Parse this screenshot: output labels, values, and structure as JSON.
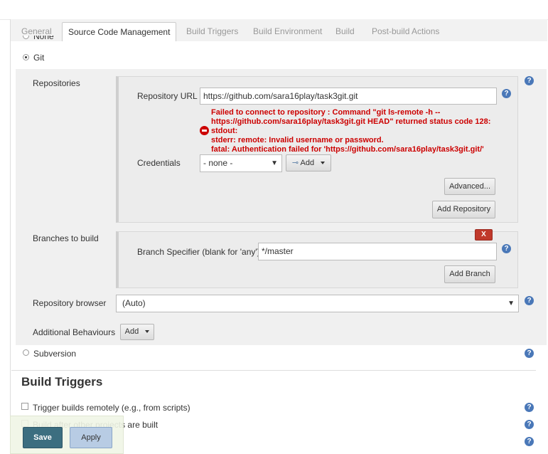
{
  "tabs": [
    {
      "label": "General"
    },
    {
      "label": "Source Code Management"
    },
    {
      "label": "Build Triggers"
    },
    {
      "label": "Build Environment"
    },
    {
      "label": "Build"
    },
    {
      "label": "Post-build Actions"
    }
  ],
  "scm": {
    "none_label": "None",
    "git_label": "Git",
    "subversion_label": "Subversion"
  },
  "repositories": {
    "section_label": "Repositories",
    "url_label": "Repository URL",
    "url_value": "https://github.com/sara16play/task3git.git",
    "error_lines": [
      "Failed to connect to repository : Command \"git ls-remote -h --",
      "https://github.com/sara16play/task3git.git HEAD\" returned status code 128:",
      "stdout:",
      "stderr: remote: Invalid username or password.",
      "fatal: Authentication failed for 'https://github.com/sara16play/task3git.git/'"
    ],
    "credentials_label": "Credentials",
    "credentials_value": "- none -",
    "add_label": "Add",
    "advanced_label": "Advanced...",
    "add_repository_label": "Add Repository"
  },
  "branches": {
    "section_label": "Branches to build",
    "delete_label": "X",
    "specifier_label": "Branch Specifier (blank for 'any')",
    "specifier_value": "*/master",
    "add_branch_label": "Add Branch"
  },
  "browser": {
    "label": "Repository browser",
    "value": "(Auto)"
  },
  "behaviours": {
    "label": "Additional Behaviours",
    "add_label": "Add"
  },
  "build_triggers": {
    "heading": "Build Triggers",
    "items": [
      {
        "label": "Trigger builds remotely (e.g., from scripts)"
      },
      {
        "label": "Build after other projects are built"
      }
    ]
  },
  "footer": {
    "save_label": "Save",
    "apply_label": "Apply"
  },
  "help_symbol": "?",
  "colors": {
    "error": "#cc0000",
    "save_button": "#3c6e80",
    "apply_button": "#b8cce4",
    "help_icon": "#4a78b8"
  }
}
